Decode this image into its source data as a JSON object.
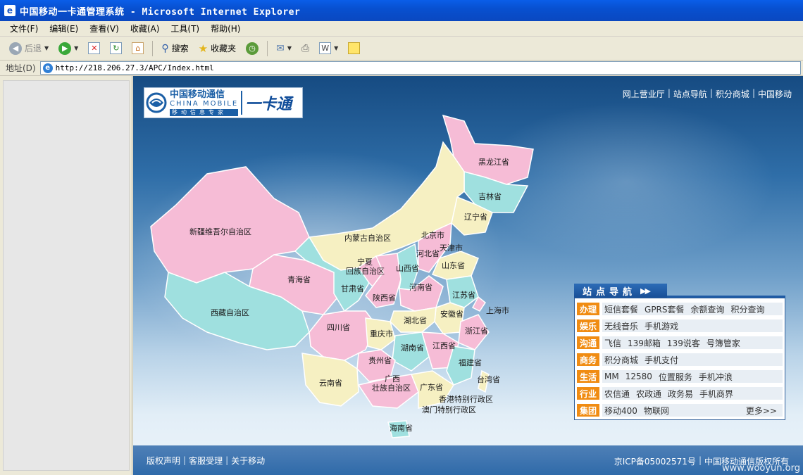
{
  "window": {
    "title": "中国移动一卡通管理系统 - Microsoft Internet Explorer"
  },
  "menu": [
    "文件(F)",
    "编辑(E)",
    "查看(V)",
    "收藏(A)",
    "工具(T)",
    "帮助(H)"
  ],
  "toolbar": {
    "back_label": "后退",
    "search_label": "搜索",
    "favorites_label": "收藏夹"
  },
  "address": {
    "label": "地址(D)",
    "url": "http://218.206.27.3/APC/Index.html"
  },
  "logo": {
    "cn": "中国移动通信",
    "en": "CHINA MOBILE",
    "tagline": "移动信息专家",
    "product": "一卡通"
  },
  "topnav": [
    "网上营业厅",
    "站点导航",
    "积分商城",
    "中国移动"
  ],
  "provinces": [
    "黑龙江省",
    "吉林省",
    "辽宁省",
    "内蒙古自治区",
    "新疆维吾尔自治区",
    "北京市",
    "天津市",
    "河北省",
    "宁夏",
    "回族自治区",
    "山西省",
    "山东省",
    "青海省",
    "甘肃省",
    "陕西省",
    "河南省",
    "江苏省",
    "西藏自治区",
    "上海市",
    "安徽省",
    "湖北省",
    "四川省",
    "重庆市",
    "浙江省",
    "湖南省",
    "江西省",
    "贵州省",
    "福建省",
    "云南省",
    "广西",
    "壮族自治区",
    "广东省",
    "台湾省",
    "香港特别行政区",
    "澳门特别行政区",
    "海南省"
  ],
  "nav": {
    "title": "站点导航",
    "rows": [
      {
        "cat": "办理",
        "links": [
          "短信套餐",
          "GPRS套餐",
          "余额查询",
          "积分查询"
        ]
      },
      {
        "cat": "娱乐",
        "links": [
          "无线音乐",
          "手机游戏"
        ]
      },
      {
        "cat": "沟通",
        "links": [
          "飞信",
          "139邮箱",
          "139说客",
          "号簿管家"
        ]
      },
      {
        "cat": "商务",
        "links": [
          "积分商城",
          "手机支付"
        ]
      },
      {
        "cat": "生活",
        "links": [
          "MM",
          "12580",
          "位置服务",
          "手机冲浪"
        ]
      },
      {
        "cat": "行业",
        "links": [
          "农信通",
          "农政通",
          "政务易",
          "手机商界"
        ]
      },
      {
        "cat": "集团",
        "links": [
          "移动400",
          "物联网"
        ],
        "more": "更多>>"
      }
    ]
  },
  "footer": {
    "left": [
      "版权声明",
      "客服受理",
      "关于移动"
    ],
    "icp": "京ICP备05002571号",
    "copyright": "中国移动通信版权所有"
  },
  "watermark": "www.wooyun.org",
  "colors": {
    "accent_orange": "#f08c13",
    "nav_blue": "#1e5aa4",
    "title_blue": "#0a5ee8"
  }
}
